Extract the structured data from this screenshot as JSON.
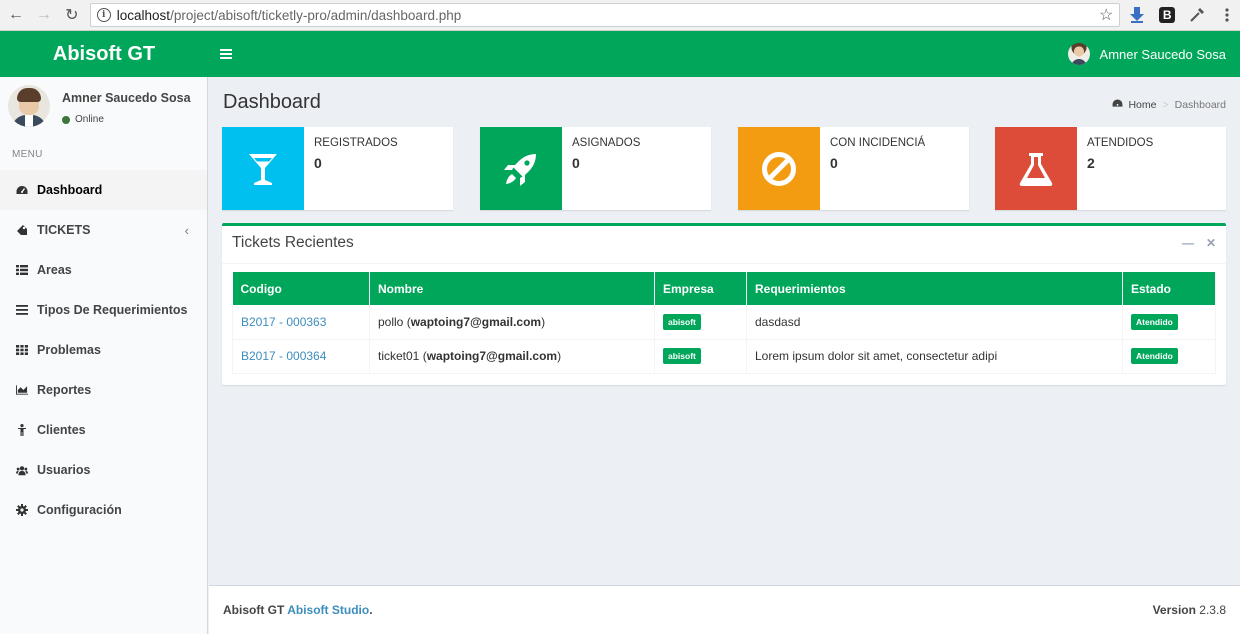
{
  "browser": {
    "url_host": "localhost",
    "url_path": "/project/abisoft/ticketly-pro/admin/dashboard.php"
  },
  "header": {
    "brand": "Abisoft GT",
    "user_name": "Amner Saucedo Sosa"
  },
  "sidebar": {
    "user_name": "Amner Saucedo Sosa",
    "status": "Online",
    "menu_header": "MENU",
    "items": [
      {
        "label": "Dashboard",
        "icon": "dashboard-icon",
        "active": true
      },
      {
        "label": "TICKETS",
        "icon": "ticket-icon",
        "has_caret": true
      },
      {
        "label": "Areas",
        "icon": "table-icon"
      },
      {
        "label": "Tipos De Requerimientos",
        "icon": "list-icon"
      },
      {
        "label": "Problemas",
        "icon": "grid-icon"
      },
      {
        "label": "Reportes",
        "icon": "area-chart-icon"
      },
      {
        "label": "Clientes",
        "icon": "person-icon"
      },
      {
        "label": "Usuarios",
        "icon": "users-icon"
      },
      {
        "label": "Configuración",
        "icon": "gear-icon"
      }
    ]
  },
  "page": {
    "title": "Dashboard",
    "breadcrumb_home": "Home",
    "breadcrumb_current": "Dashboard"
  },
  "info_boxes": [
    {
      "label": "REGISTRADOS",
      "value": "0",
      "color": "#00c0ef",
      "icon": "cocktail-glass-icon"
    },
    {
      "label": "ASIGNADOS",
      "value": "0",
      "color": "#00a65a",
      "icon": "rocket-icon"
    },
    {
      "label": "CON INCIDENCIÁ",
      "value": "0",
      "color": "#f39c12",
      "icon": "ban-icon"
    },
    {
      "label": "ATENDIDOS",
      "value": "2",
      "color": "#dd4b39",
      "icon": "flask-icon"
    }
  ],
  "recent": {
    "title": "Tickets Recientes",
    "columns": [
      "Codigo",
      "Nombre",
      "Empresa",
      "Requerimientos",
      "Estado"
    ],
    "rows": [
      {
        "code": "B2017 - 000363",
        "name": "pollo",
        "email": "waptoing7@gmail.com",
        "company": "abisoft",
        "requirement": "dasdasd",
        "status": "Atendido"
      },
      {
        "code": "B2017 - 000364",
        "name": "ticket01",
        "email": "waptoing7@gmail.com",
        "company": "abisoft",
        "requirement": "Lorem ipsum dolor sit amet, consectetur adipi",
        "status": "Atendido"
      }
    ]
  },
  "footer": {
    "brand": "Abisoft GT",
    "studio": "Abisoft Studio",
    "version_label": "Version",
    "version": "2.3.8"
  },
  "colors": {
    "primary": "#00a65a",
    "link": "#3c8dbc"
  }
}
